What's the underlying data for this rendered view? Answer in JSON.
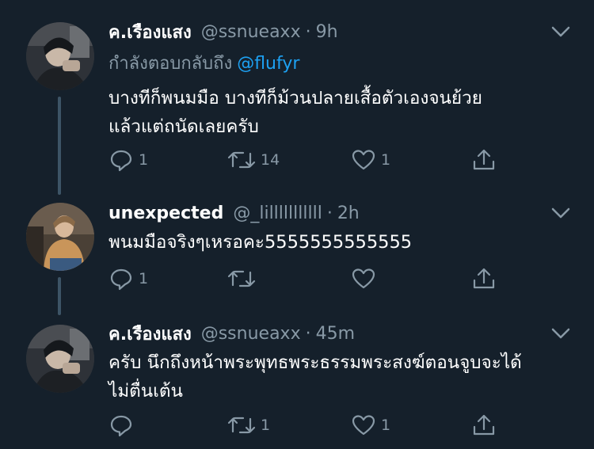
{
  "tweets": [
    {
      "name": "ค.เรืองแสง",
      "handle": "@ssnueaxx",
      "time": "9h",
      "replying_label": "กำลังตอบกลับถึง",
      "replying_to": "@flufyr",
      "text": "บางทีก็พนมมือ บางทีก็ม้วนปลายเสื้อตัวเองจนย้วย\nแล้วแต่ถนัดเลยครับ",
      "replies": "1",
      "retweets": "14",
      "likes": "1"
    },
    {
      "name": "unexpected",
      "handle": "@_lilllllllllll",
      "time": "2h",
      "text": "พนมมือจริงๆเหรอคะ5555555555555",
      "replies": "1",
      "retweets": "",
      "likes": ""
    },
    {
      "name": "ค.เรืองแสง",
      "handle": "@ssnueaxx",
      "time": "45m",
      "text": "ครับ นึกถึงหน้าพระพุทธพระธรรมพระสงฆ์ตอนจูบจะได้\nไม่ตื่นเต้น",
      "replies": "",
      "retweets": "1",
      "likes": "1"
    }
  ],
  "separator": "·",
  "icons": [
    "reply-icon",
    "retweet-icon",
    "like-icon",
    "share-icon",
    "chevron-down-icon"
  ],
  "colors": {
    "background": "#15202b",
    "secondary_text": "#8899a6",
    "link": "#1da1f2",
    "thread_line": "#3d5466"
  }
}
